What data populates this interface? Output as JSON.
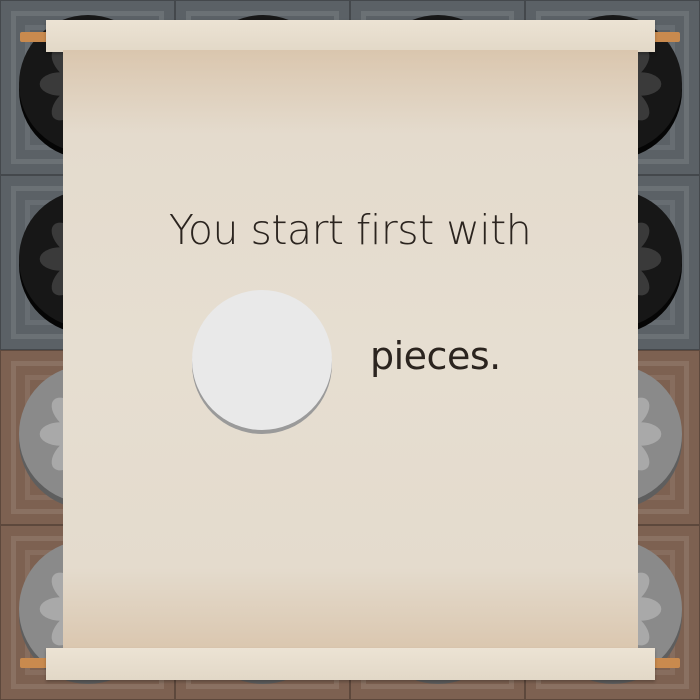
{
  "board": {
    "cells": [
      {
        "row": 0,
        "col": 0,
        "tile": "gray",
        "piece": "black"
      },
      {
        "row": 0,
        "col": 1,
        "tile": "gray",
        "piece": "black"
      },
      {
        "row": 0,
        "col": 2,
        "tile": "gray",
        "piece": "black"
      },
      {
        "row": 0,
        "col": 3,
        "tile": "gray",
        "piece": "black"
      },
      {
        "row": 1,
        "col": 0,
        "tile": "gray",
        "piece": "black"
      },
      {
        "row": 1,
        "col": 1,
        "tile": "gray",
        "piece": "black"
      },
      {
        "row": 1,
        "col": 2,
        "tile": "gray",
        "piece": "black"
      },
      {
        "row": 1,
        "col": 3,
        "tile": "gray",
        "piece": "black"
      },
      {
        "row": 2,
        "col": 0,
        "tile": "brown",
        "piece": "gray"
      },
      {
        "row": 2,
        "col": 1,
        "tile": "brown",
        "piece": "gray"
      },
      {
        "row": 2,
        "col": 2,
        "tile": "brown",
        "piece": "gray"
      },
      {
        "row": 2,
        "col": 3,
        "tile": "brown",
        "piece": "gray"
      },
      {
        "row": 3,
        "col": 0,
        "tile": "brown",
        "piece": "gray"
      },
      {
        "row": 3,
        "col": 1,
        "tile": "brown",
        "piece": "gray"
      },
      {
        "row": 3,
        "col": 2,
        "tile": "brown",
        "piece": "gray"
      },
      {
        "row": 3,
        "col": 3,
        "tile": "brown",
        "piece": "gray"
      }
    ]
  },
  "colors": {
    "tile_gray": "#5b6166",
    "tile_brown": "#7d6151",
    "piece_black": "#171717",
    "piece_black_petal": "#3a3a3a",
    "piece_gray": "#8a8a8a",
    "piece_gray_petal": "#a9a9a9",
    "piece_white": "#e9e9e9",
    "piece_white_petal": "#cfcfcf",
    "text": "#2b241f"
  },
  "dialog": {
    "line1": "You start first with",
    "line2": "pieces.",
    "piece_color": "white",
    "icon": "white-piece-icon"
  }
}
